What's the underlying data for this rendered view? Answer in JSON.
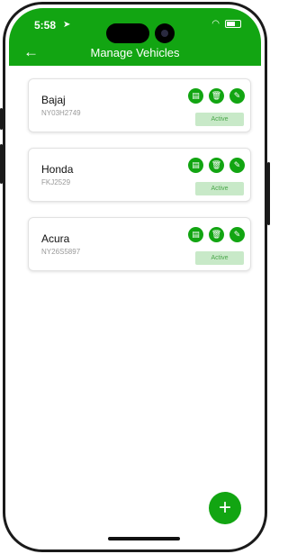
{
  "status": {
    "time": "5:58"
  },
  "header": {
    "title": "Manage Vehicles"
  },
  "vehicles": [
    {
      "name": "Bajaj",
      "plate": "NY03H2749",
      "status": "Active"
    },
    {
      "name": "Honda",
      "plate": "FKJ2529",
      "status": "Active"
    },
    {
      "name": "Acura",
      "plate": "NY26S5897",
      "status": "Active"
    }
  ],
  "colors": {
    "accent": "#12a512",
    "active_bg": "#c8e9c8",
    "active_text": "#4aa64a"
  },
  "icons": [
    "arrow-left-icon",
    "clipboard-icon",
    "trash-icon",
    "pencil-icon",
    "plus-icon"
  ]
}
